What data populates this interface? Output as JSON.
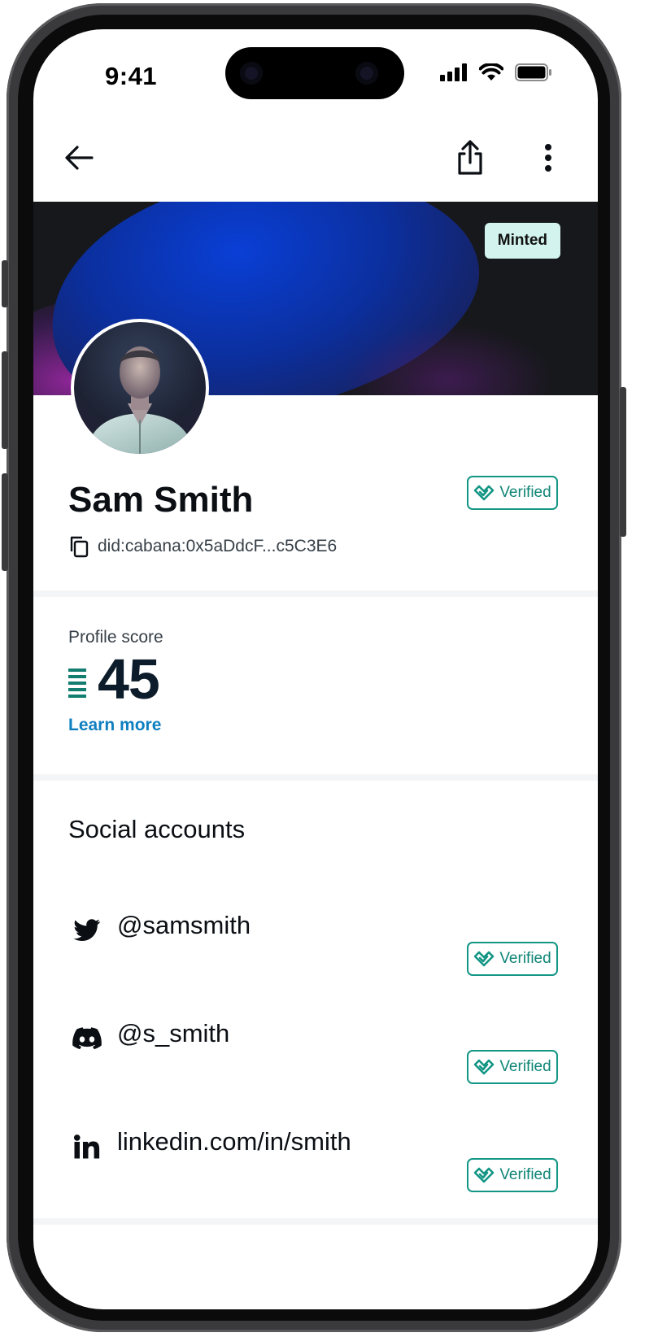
{
  "status_bar": {
    "time": "9:41"
  },
  "banner": {
    "badge": "Minted"
  },
  "profile": {
    "name": "Sam Smith",
    "did": "did:cabana:0x5aDdcF...c5C3E6",
    "verified_label": "Verified"
  },
  "score": {
    "label": "Profile score",
    "value": "45",
    "learn_more": "Learn more"
  },
  "social": {
    "title": "Social accounts",
    "accounts": [
      {
        "icon": "twitter-icon",
        "handle": "@samsmith",
        "status": "Verified"
      },
      {
        "icon": "discord-icon",
        "handle": "@s_smith",
        "status": "Verified"
      },
      {
        "icon": "linkedin-icon",
        "handle": "linkedin.com/in/smith",
        "status": "Verified"
      }
    ]
  },
  "colors": {
    "accent_teal": "#139685",
    "link_blue": "#0f7fc0",
    "minted_bg": "#d3f4ee",
    "banner_bg": "#17181c"
  }
}
